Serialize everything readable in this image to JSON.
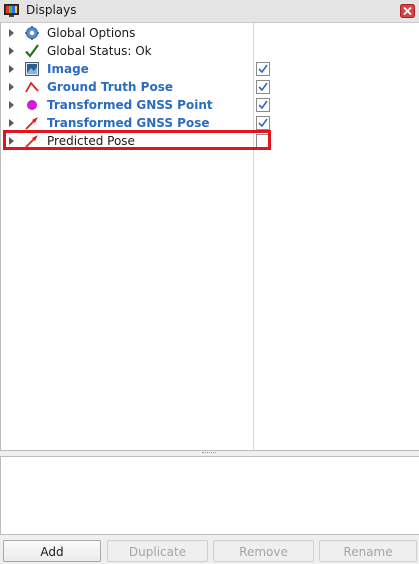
{
  "window": {
    "title": "Displays",
    "icon": "monitor-icon",
    "close_icon": "close-icon"
  },
  "displays": [
    {
      "label": "Global Options",
      "icon": "gear-icon",
      "enabled": null,
      "highlighted": false
    },
    {
      "label": "Global Status: Ok",
      "icon": "checkmark-icon",
      "enabled": null,
      "highlighted": false
    },
    {
      "label": "Image",
      "icon": "image-icon",
      "enabled": true,
      "highlighted": false
    },
    {
      "label": "Ground Truth Pose",
      "icon": "pose-path-icon",
      "enabled": true,
      "highlighted": false
    },
    {
      "label": "Transformed GNSS Point",
      "icon": "point-icon",
      "enabled": true,
      "highlighted": false
    },
    {
      "label": "Transformed GNSS Pose",
      "icon": "pose-arrow-icon",
      "enabled": true,
      "highlighted": false
    },
    {
      "label": "Predicted Pose",
      "icon": "pose-arrow-icon",
      "enabled": false,
      "highlighted": true
    }
  ],
  "buttons": {
    "add": "Add",
    "duplicate": "Duplicate",
    "remove": "Remove",
    "rename": "Rename"
  },
  "colors": {
    "accent_label": "#2b6cc0",
    "highlight_border": "#e0151e",
    "pose_icon": "#e0201a",
    "point_icon": "#d21bd4",
    "check": "#1a7a1a"
  }
}
